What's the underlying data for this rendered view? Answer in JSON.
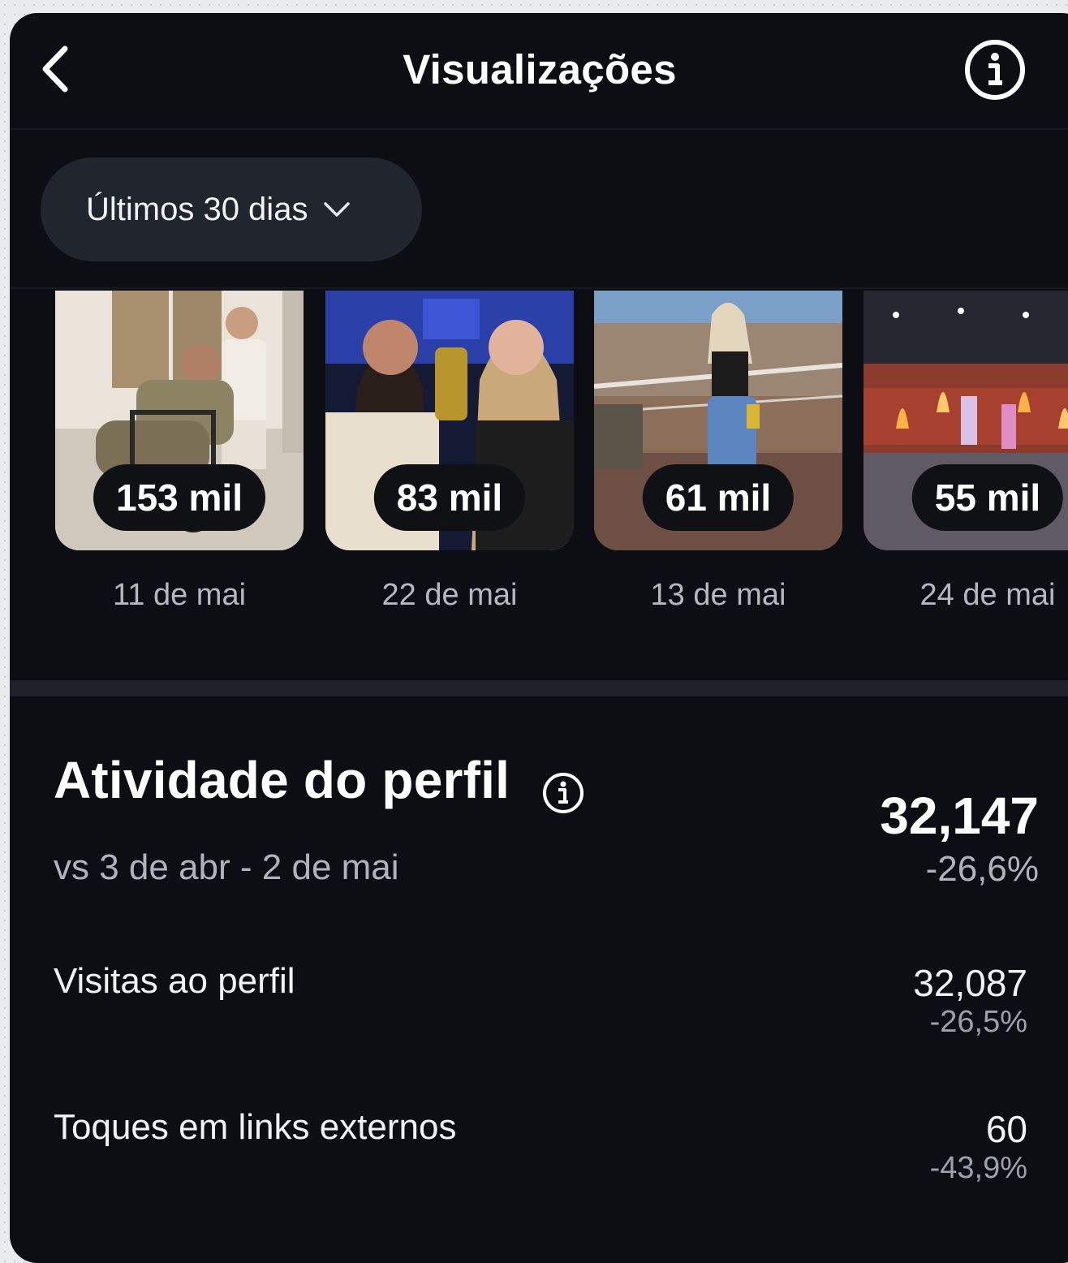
{
  "header": {
    "title": "Visualizações",
    "back_icon": "chevron-left-icon",
    "info_icon": "info-circle-icon"
  },
  "filter": {
    "label": "Últimos 30 dias",
    "icon": "chevron-down-icon"
  },
  "posts": [
    {
      "views": "153 mil",
      "date": "11 de mai"
    },
    {
      "views": "83 mil",
      "date": "22 de mai"
    },
    {
      "views": "61 mil",
      "date": "13 de mai"
    },
    {
      "views": "55 mil",
      "date": "24 de mai"
    }
  ],
  "activity": {
    "title": "Atividade do perfil",
    "comparison": "vs 3 de abr - 2 de mai",
    "total": "32,147",
    "change": "-26,6%",
    "metrics": [
      {
        "label": "Visitas ao perfil",
        "value": "32,087",
        "change": "-26,5%"
      },
      {
        "label": "Toques em links externos",
        "value": "60",
        "change": "-43,9%"
      }
    ]
  },
  "colors": {
    "background": "#0c0e13",
    "pill": "#21252d",
    "muted_text": "#aeb3bd"
  }
}
